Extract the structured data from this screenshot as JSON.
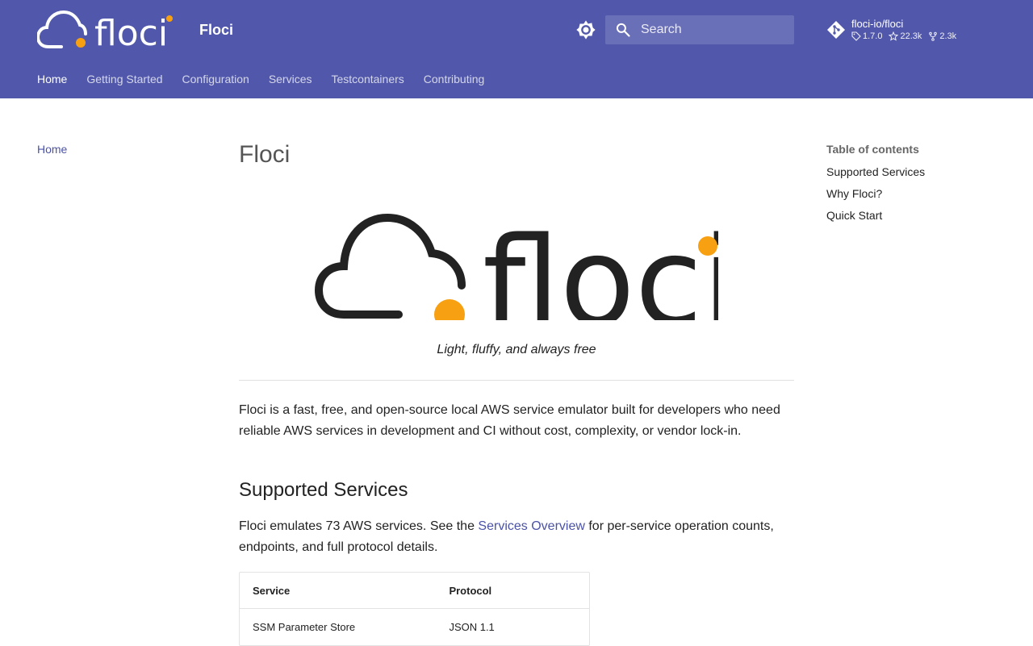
{
  "header": {
    "site_title": "Floci",
    "search_placeholder": "Search",
    "repo": {
      "name": "floci-io/floci",
      "version": "1.7.0",
      "stars": "22.3k",
      "forks": "2.3k"
    }
  },
  "tabs": [
    {
      "label": "Home",
      "active": true
    },
    {
      "label": "Getting Started"
    },
    {
      "label": "Configuration"
    },
    {
      "label": "Services"
    },
    {
      "label": "Testcontainers"
    },
    {
      "label": "Contributing"
    }
  ],
  "left_nav": {
    "items": [
      {
        "label": "Home"
      }
    ]
  },
  "toc": {
    "title": "Table of contents",
    "items": [
      {
        "label": "Supported Services"
      },
      {
        "label": "Why Floci?"
      },
      {
        "label": "Quick Start"
      }
    ]
  },
  "content": {
    "title": "Floci",
    "tagline": "Light, fluffy, and always free",
    "intro": "Floci is a fast, free, and open-source local AWS service emulator built for developers who need reliable AWS services in development and CI without cost, complexity, or vendor lock-in.",
    "supported_heading": "Supported Services",
    "services_pre": "Floci emulates 73 AWS services. See the ",
    "services_link": "Services Overview",
    "services_post": " for per-service operation counts, endpoints, and full protocol details.",
    "table": {
      "headers": [
        "Service",
        "Protocol"
      ],
      "rows": [
        [
          "SSM Parameter Store",
          "JSON 1.1"
        ]
      ]
    }
  },
  "colors": {
    "header_bg": "#5158ab",
    "accent_orange": "#f7a012",
    "link": "#4b52a6"
  },
  "icons": [
    "floci-logo",
    "theme-toggle-icon",
    "search-icon",
    "git-icon",
    "tag-icon",
    "star-icon",
    "fork-icon"
  ]
}
